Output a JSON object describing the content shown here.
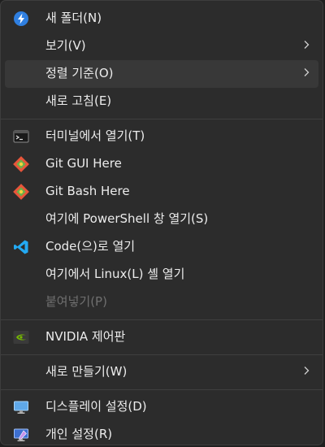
{
  "menu": {
    "items": [
      {
        "label": "새 폴더(N)",
        "icon": "new-folder-icon"
      },
      {
        "label": "보기(V)",
        "has_submenu": true
      },
      {
        "label": "정렬 기준(O)",
        "has_submenu": true,
        "highlighted": true
      },
      {
        "label": "새로 고침(E)"
      },
      {
        "label": "터미널에서 열기(T)",
        "icon": "terminal-icon"
      },
      {
        "label": "Git GUI Here",
        "icon": "git-icon"
      },
      {
        "label": "Git Bash Here",
        "icon": "git-icon"
      },
      {
        "label": "여기에 PowerShell 창 열기(S)"
      },
      {
        "label": "Code(으)로 열기",
        "icon": "vscode-icon"
      },
      {
        "label": "여기에서 Linux(L) 셸 열기"
      },
      {
        "label": "붙여넣기(P)",
        "disabled": true
      },
      {
        "label": "NVIDIA 제어판",
        "icon": "nvidia-icon"
      },
      {
        "label": "새로 만들기(W)",
        "has_submenu": true
      },
      {
        "label": "디스플레이 설정(D)",
        "icon": "display-icon"
      },
      {
        "label": "개인 설정(R)",
        "icon": "personalize-icon"
      }
    ]
  },
  "colors": {
    "background": "#2c2c2c",
    "hover": "#383838",
    "text": "#ececec",
    "disabled_text": "#6f6f6f",
    "separator": "#3f3f3f"
  }
}
